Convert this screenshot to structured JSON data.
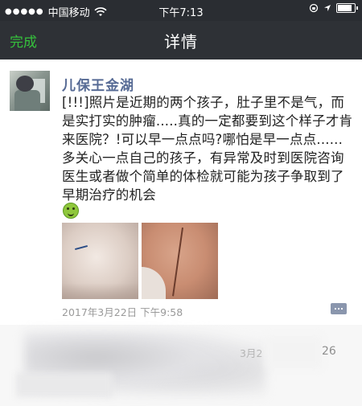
{
  "status_bar": {
    "signal_dots": "●●●●●",
    "carrier": "中国移动",
    "time": "下午7:13"
  },
  "nav": {
    "done_label": "完成",
    "title": "详情"
  },
  "post": {
    "author": "儿保王金湖",
    "content": "[!!!]照片是近期的两个孩子，肚子里不是气，而是实打实的肿瘤.....真的一定都要到这个样子才肯来医院？!可以早一点点吗?哪怕是早一点点......多关心一点自己的孩子，有异常及时到医院咨询医生或者做个简单的体检就可能为孩子争取到了早期治疗的机会",
    "timestamp": "2017年3月22日 下午9:58"
  },
  "redacted_row": {
    "date_fragment": "3月2",
    "number_fragment": "26"
  },
  "colors": {
    "nav_background": "#2e3136",
    "done_green": "#35c13c",
    "author_link": "#576b95"
  }
}
